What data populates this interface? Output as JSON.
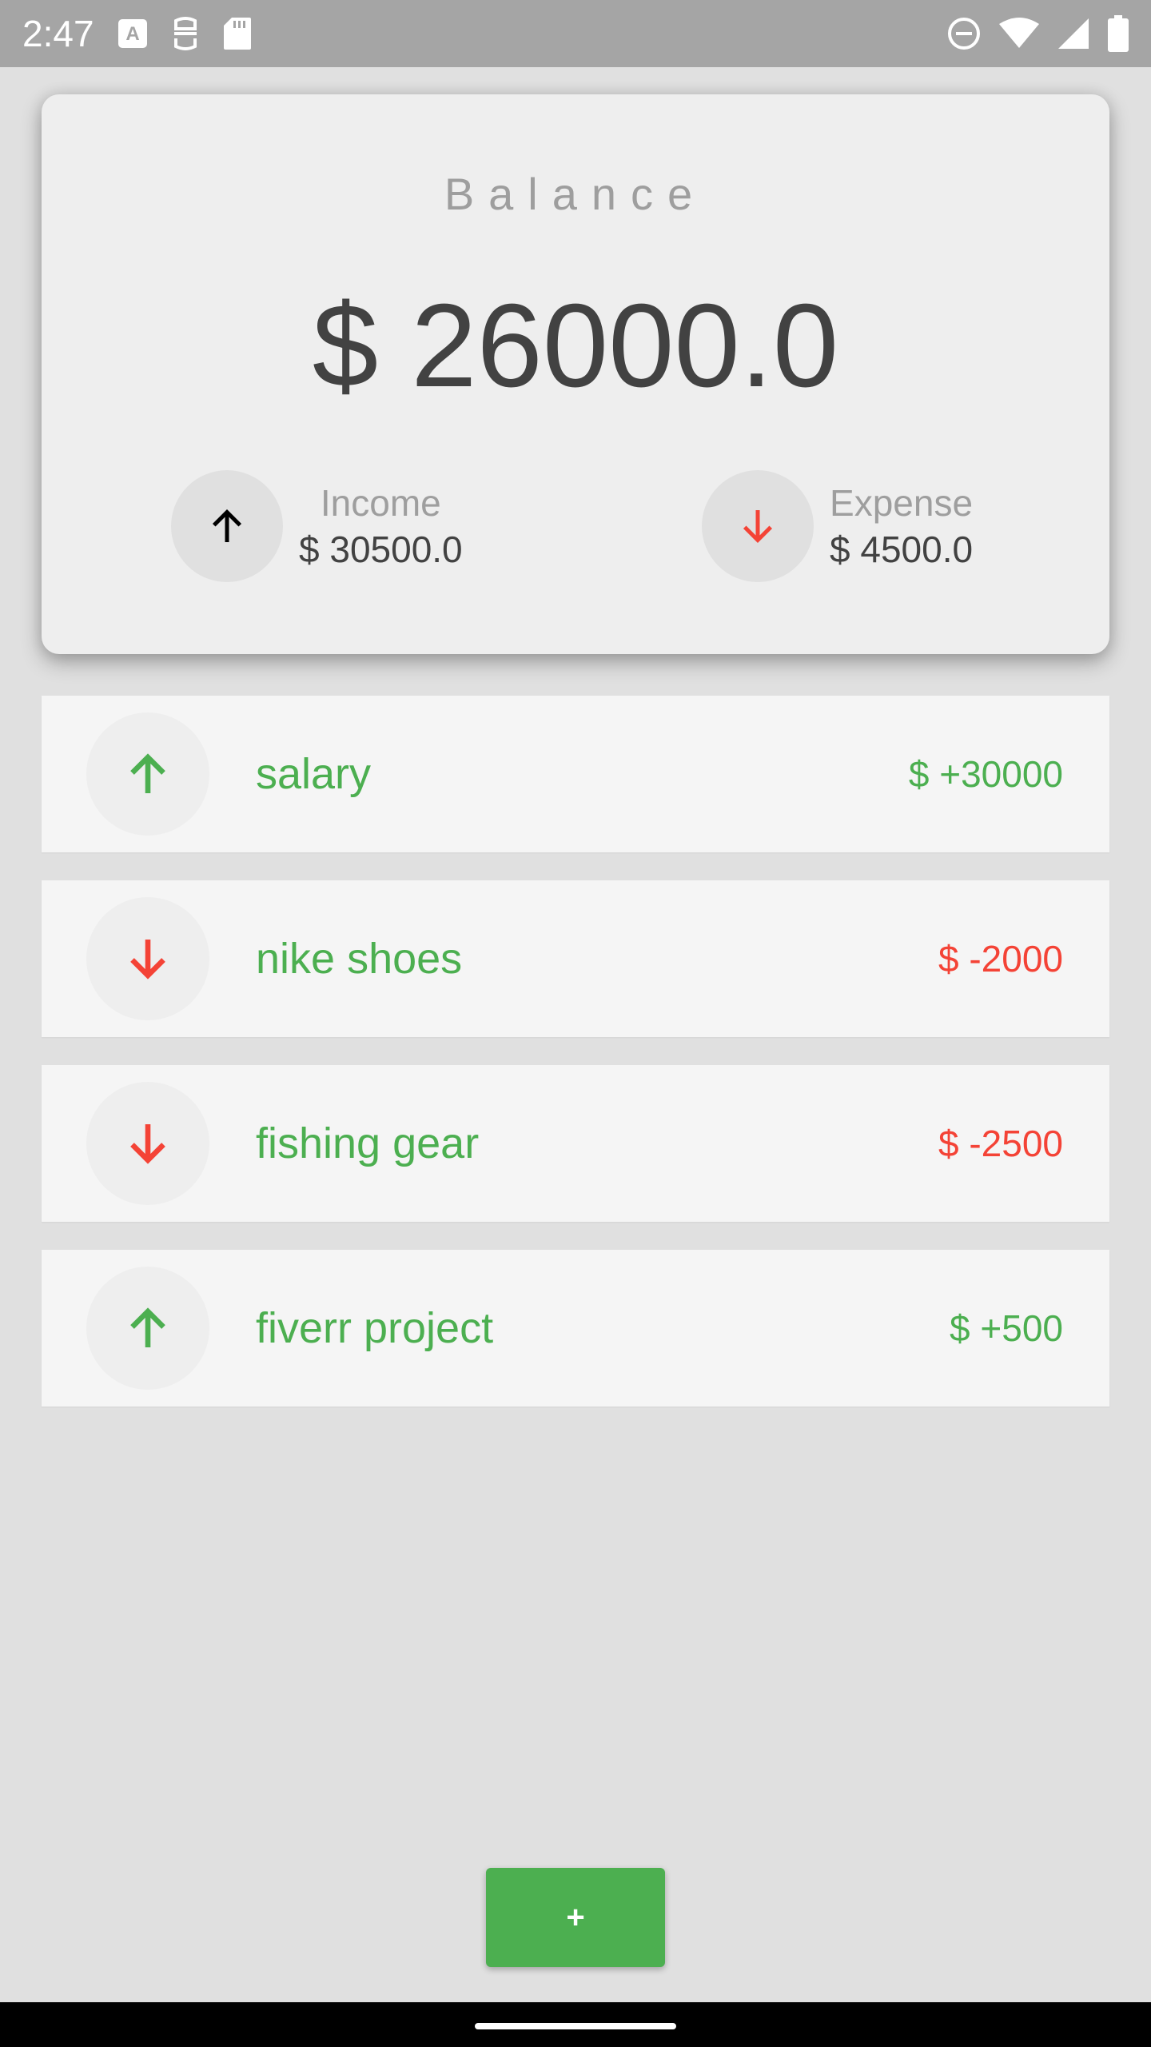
{
  "status_bar": {
    "time": "2:47",
    "left_icons": [
      "text-a-icon",
      "robot-face-icon",
      "sd-card-icon"
    ],
    "right_icons": [
      "do-not-disturb-icon",
      "wifi-icon",
      "cellular-signal-icon",
      "battery-icon"
    ]
  },
  "balance": {
    "label": "Balance",
    "amount": "$ 26000.0",
    "income": {
      "label": "Income",
      "value": "$ 30500.0",
      "icon": "arrow-up-icon",
      "icon_color": "#000000"
    },
    "expense": {
      "label": "Expense",
      "value": "$ 4500.0",
      "icon": "arrow-down-icon",
      "icon_color": "#f44336"
    }
  },
  "transactions": [
    {
      "title": "salary",
      "amount": "$ +30000",
      "direction": "up",
      "icon": "arrow-up-icon",
      "amount_color": "#4caf50"
    },
    {
      "title": "nike shoes",
      "amount": "$ -2000",
      "direction": "down",
      "icon": "arrow-down-icon",
      "amount_color": "#f44336"
    },
    {
      "title": "fishing gear",
      "amount": "$ -2500",
      "direction": "down",
      "icon": "arrow-down-icon",
      "amount_color": "#f44336"
    },
    {
      "title": "fiverr project",
      "amount": "$ +500",
      "direction": "up",
      "icon": "arrow-up-icon",
      "amount_color": "#4caf50"
    }
  ],
  "add_button": {
    "label": "+"
  },
  "colors": {
    "accent_green": "#4caf50",
    "accent_red": "#f44336",
    "background": "#e0e0e0",
    "card": "#eeeeee"
  }
}
